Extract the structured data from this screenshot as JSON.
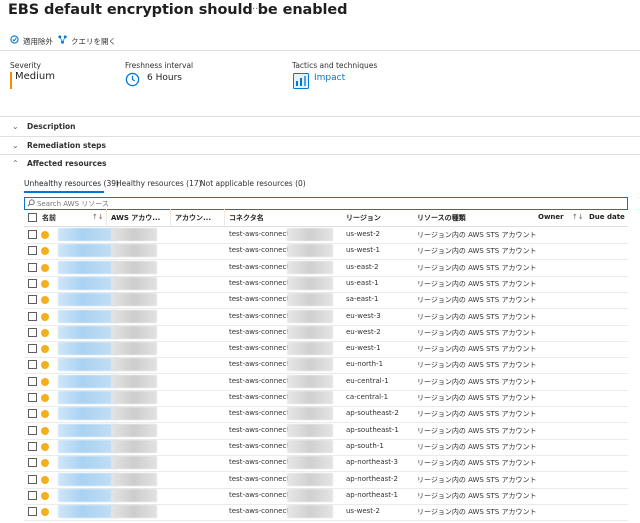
{
  "header": {
    "title": "EBS default encryption should be enabled",
    "more": "···"
  },
  "toolbar": {
    "exempt_label": "適用除外",
    "exempt_icon": "exempt-icon",
    "query_label": "クエリを開く",
    "query_icon": "query-icon"
  },
  "summary": {
    "severity_label": "Severity",
    "severity_value": "Medium",
    "severity_color": "#ff8c00",
    "freshness_label": "Freshness interval",
    "freshness_value": "6 Hours",
    "freshness_icon": "clock-icon",
    "tactics_label": "Tactics and techniques",
    "tactics_value": "Impact",
    "tactics_icon": "impact-icon"
  },
  "sections": {
    "description": "Description",
    "remediation": "Remediation steps",
    "affected": "Affected resources"
  },
  "tabs": [
    "Unhealthy resources (39)",
    "Healthy resources (17)",
    "Not applicable resources (0)"
  ],
  "search": {
    "placeholder": "Search AWS リソース"
  },
  "table": {
    "columns": {
      "name": "名前",
      "aws_account": "AWS アカウ...",
      "account": "アカウン...",
      "connector": "コネクタ名",
      "region": "リージョン",
      "resource_type": "リソースの種類",
      "owner": "Owner",
      "due_date": "Due date"
    },
    "rows": [
      {
        "connector": "test-aws-connector_",
        "region": "us-west-2",
        "type": "リージョン内の AWS STS アカウント"
      },
      {
        "connector": "test-aws-connector_",
        "region": "us-west-1",
        "type": "リージョン内の AWS STS アカウント"
      },
      {
        "connector": "test-aws-connector_",
        "region": "us-east-2",
        "type": "リージョン内の AWS STS アカウント"
      },
      {
        "connector": "test-aws-connector_",
        "region": "us-east-1",
        "type": "リージョン内の AWS STS アカウント"
      },
      {
        "connector": "test-aws-connector_",
        "region": "sa-east-1",
        "type": "リージョン内の AWS STS アカウント"
      },
      {
        "connector": "test-aws-connector_",
        "region": "eu-west-3",
        "type": "リージョン内の AWS STS アカウント"
      },
      {
        "connector": "test-aws-connector_",
        "region": "eu-west-2",
        "type": "リージョン内の AWS STS アカウント"
      },
      {
        "connector": "test-aws-connector_",
        "region": "eu-west-1",
        "type": "リージョン内の AWS STS アカウント"
      },
      {
        "connector": "test-aws-connector_",
        "region": "eu-north-1",
        "type": "リージョン内の AWS STS アカウント"
      },
      {
        "connector": "test-aws-connector_",
        "region": "eu-central-1",
        "type": "リージョン内の AWS STS アカウント"
      },
      {
        "connector": "test-aws-connector_",
        "region": "ca-central-1",
        "type": "リージョン内の AWS STS アカウント"
      },
      {
        "connector": "test-aws-connector_",
        "region": "ap-southeast-2",
        "type": "リージョン内の AWS STS アカウント"
      },
      {
        "connector": "test-aws-connector_",
        "region": "ap-southeast-1",
        "type": "リージョン内の AWS STS アカウント"
      },
      {
        "connector": "test-aws-connector_",
        "region": "ap-south-1",
        "type": "リージョン内の AWS STS アカウント"
      },
      {
        "connector": "test-aws-connector_",
        "region": "ap-northeast-3",
        "type": "リージョン内の AWS STS アカウント"
      },
      {
        "connector": "test-aws-connector_",
        "region": "ap-northeast-2",
        "type": "リージョン内の AWS STS アカウント"
      },
      {
        "connector": "test-aws-connector_",
        "region": "ap-northeast-1",
        "type": "リージョン内の AWS STS アカウント"
      },
      {
        "connector": "test-aws-connector",
        "region": "us-west-2",
        "type": "リージョン内の AWS STS アカウント"
      }
    ]
  }
}
